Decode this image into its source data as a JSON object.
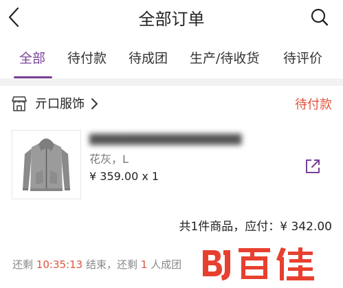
{
  "header": {
    "title": "全部订单"
  },
  "tabs": [
    {
      "label": "全部",
      "active": true
    },
    {
      "label": "待付款"
    },
    {
      "label": "待成团"
    },
    {
      "label": "生产/待收货"
    },
    {
      "label": "待评价"
    }
  ],
  "order": {
    "shop_name": "亓口服饰",
    "status": "待付款",
    "product": {
      "spec": "花灰，L",
      "price_line": "¥ 359.00 x 1"
    },
    "summary": "共1件商品，应付：¥ 342.00",
    "countdown": {
      "prefix": "还剩",
      "time": "10:35:13",
      "middle": "结束，还剩",
      "people": "1",
      "suffix": "人成团"
    }
  },
  "watermark": {
    "logo": "BJ",
    "text": "百佳"
  },
  "colors": {
    "accent": "#7a3f97",
    "status": "#e0533c",
    "watermark": "#e8402f"
  },
  "icons": [
    "back-icon",
    "search-icon",
    "shop-icon",
    "chevron-right-icon",
    "share-icon"
  ]
}
